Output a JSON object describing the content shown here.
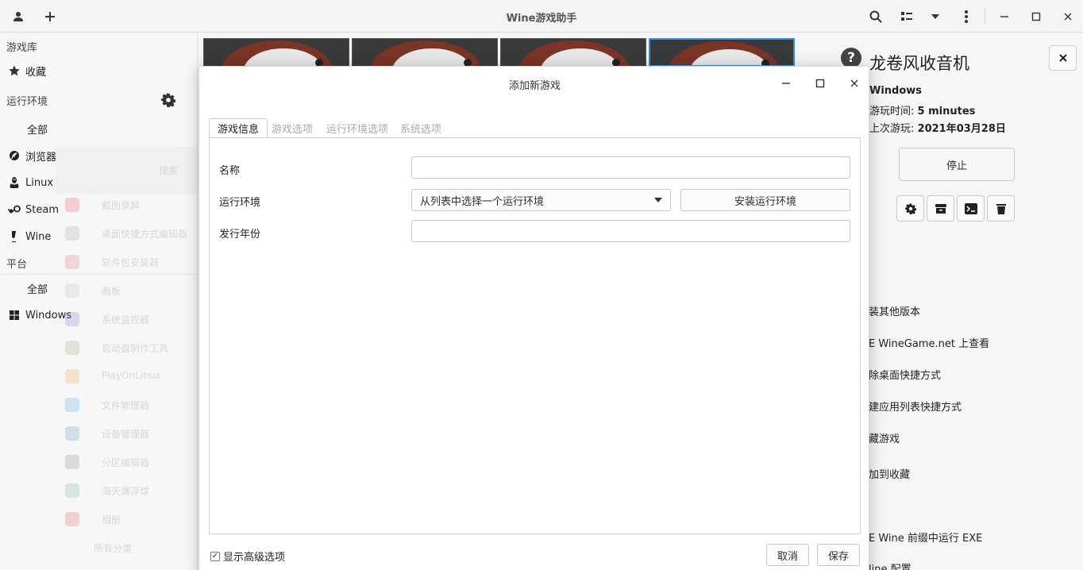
{
  "app": {
    "title": "Wine游戏助手"
  },
  "sidebar": {
    "library_label": "游戏库",
    "favorites": "收藏",
    "runners_label": "运行环境",
    "runners": [
      "全部",
      "浏览器",
      "Linux",
      "Steam",
      "Wine"
    ],
    "platforms_label": "平台",
    "platforms": [
      "全部",
      "Windows"
    ]
  },
  "background_launcher": {
    "search": "搜索",
    "items": [
      "截图录屏",
      "桌面快捷方式编辑器",
      "软件包安装器",
      "画板",
      "系统监视器",
      "启动盘制作工具",
      "PlayOnLinux",
      "文件管理器",
      "设备管理器",
      "分区编辑器",
      "海天鹰浮球",
      "相册",
      "所有分类"
    ]
  },
  "detail": {
    "game_title": "龙卷风收音机",
    "platform": "Windows",
    "playtime_label": "游玩时间:",
    "playtime_value": "5 minutes",
    "last_played_label": "上次游玩:",
    "last_played_value": "2021年03月28日",
    "stop_button": "停止",
    "actions": [
      "装其他版本",
      "E WineGame.net 上查看",
      "除桌面快捷方式",
      "建应用列表快捷方式",
      "藏游戏",
      "加到收藏",
      "E Wine 前缀中运行 EXE",
      "line 配置"
    ]
  },
  "dialog": {
    "title": "添加新游戏",
    "tabs": [
      "游戏信息",
      "游戏选项",
      "运行环境选项",
      "系统选项"
    ],
    "active_tab": "游戏信息",
    "fields": {
      "name_label": "名称",
      "name_value": "",
      "runner_label": "运行环境",
      "runner_value": "从列表中选择一个运行环境",
      "install_runner_button": "安装运行环境",
      "year_label": "发行年份",
      "year_value": ""
    },
    "advanced_checkbox": "显示高级选项",
    "advanced_checked": true,
    "cancel_button": "取消",
    "save_button": "保存"
  },
  "colors": {
    "accent": "#3b8fd6",
    "cover_bg": "#3a3a3a"
  }
}
